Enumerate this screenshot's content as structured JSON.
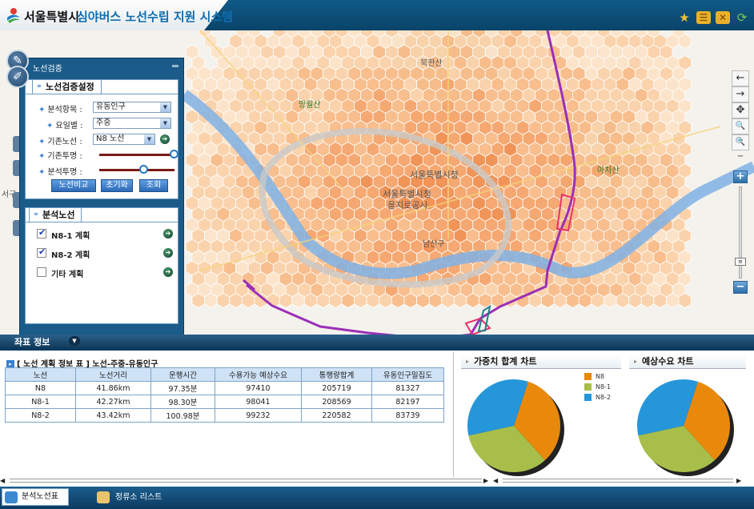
{
  "header": {
    "city_name": "서울특별시",
    "system_title": "심야버스 노선수립 지원 시스템",
    "icons": [
      "star-icon",
      "list-icon",
      "close-icon",
      "refresh-icon"
    ]
  },
  "map": {
    "labels": {
      "bukhansan": "북한산",
      "mangwolsan": "망월산",
      "seoul_city_hall_1": "서울특별시청",
      "seoul_city_hall_2": "서울특별시청",
      "euljiro": "을지로공사",
      "namsan": "남산구",
      "achasan": "아차산",
      "gangseo": "강서구",
      "seo": "서구"
    },
    "nav_buttons": [
      "←",
      "→",
      "✥",
      "🔍+",
      "🔍−"
    ],
    "zoom": {
      "plus": "+",
      "minus": "−",
      "level": 0.15
    }
  },
  "panel": {
    "title": "노선검증",
    "settings_tab": "노선검증설정",
    "fields": [
      {
        "label": "분석항목 :",
        "value": "유동인구"
      },
      {
        "label": "요일별 :",
        "value": "주중"
      },
      {
        "label": "기존노선 :",
        "value": "N8 노선"
      },
      {
        "label": "기존투명 :"
      },
      {
        "label": "분석투명 :"
      }
    ],
    "sliders": {
      "existing_opacity": 1.0,
      "analysis_opacity": 0.6
    },
    "buttons": {
      "compare": "노선비교",
      "reset": "초기화",
      "query": "조회"
    },
    "routes_tab": "분석노선",
    "routes": [
      {
        "label": "N8-1 계획",
        "checked": true
      },
      {
        "label": "N8-2 계획",
        "checked": true
      },
      {
        "label": "기타 계획",
        "checked": false
      }
    ]
  },
  "coord_label": "좌표 정보",
  "table": {
    "title": "[ 노선 계획 정보 표 ] 노선-주중-유동인구",
    "columns": [
      "노선",
      "노선거리",
      "운행시간",
      "수용가능 예상수요",
      "통행량합계",
      "유동인구밀집도"
    ],
    "rows": [
      [
        "N8",
        "41.86km",
        "97.35분",
        "97410",
        "205719",
        "81327"
      ],
      [
        "N8-1",
        "42.27km",
        "98.30분",
        "98041",
        "208569",
        "82197"
      ],
      [
        "N8-2",
        "43.42km",
        "100.98분",
        "99232",
        "220582",
        "83739"
      ]
    ]
  },
  "charts": {
    "weighted_title": "가중치 합계 차트",
    "demand_title": "예상수요 차트",
    "legend": [
      {
        "name": "N8",
        "color": "#E8890C"
      },
      {
        "name": "N8-1",
        "color": "#A7BF4A"
      },
      {
        "name": "N8-2",
        "color": "#2596D9"
      }
    ]
  },
  "chart_data": [
    {
      "type": "pie",
      "title": "가중치 합계 차트",
      "labels": [
        "N8",
        "N8-1",
        "N8-2"
      ],
      "values": [
        33.3,
        33.3,
        33.4
      ]
    },
    {
      "type": "pie",
      "title": "예상수요 차트",
      "labels": [
        "N8",
        "N8-1",
        "N8-2"
      ],
      "values": [
        33.3,
        33.3,
        33.4
      ]
    }
  ],
  "footer": {
    "tab_analysis": "분석노선표",
    "tab_stops": "정류소 리스트"
  }
}
